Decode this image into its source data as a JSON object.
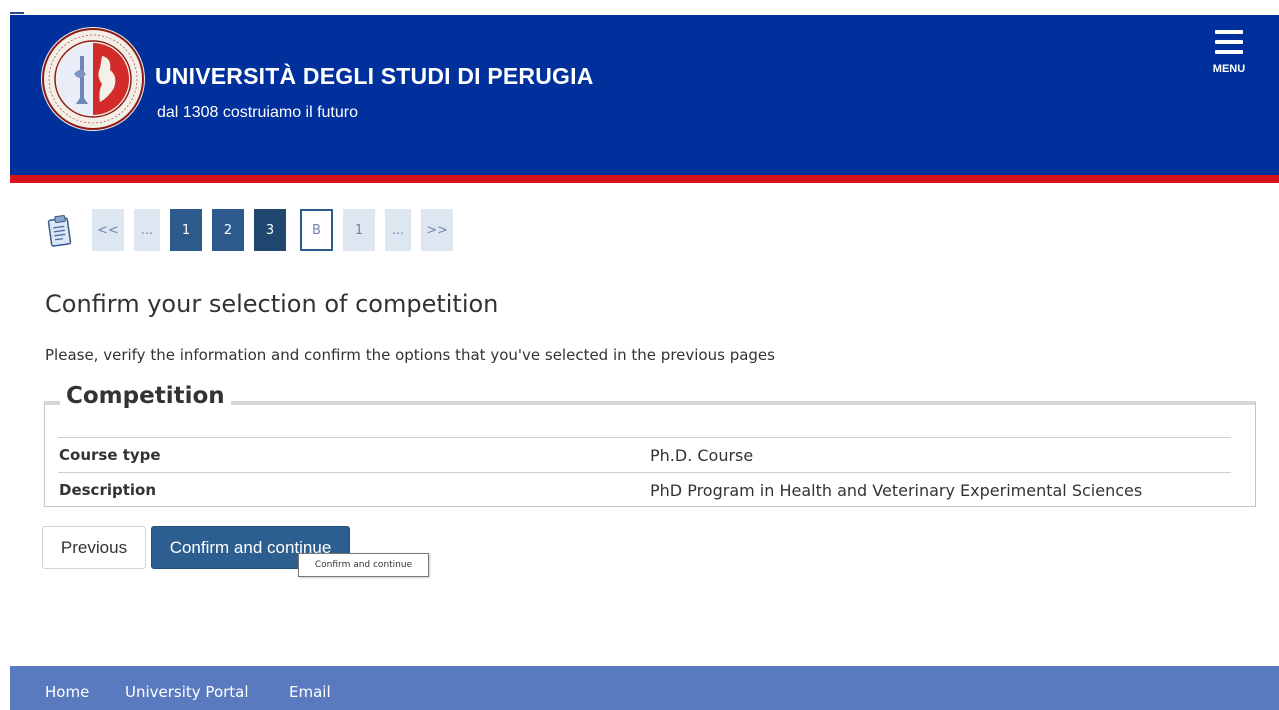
{
  "header": {
    "university_name": "UNIVERSITÀ DEGLI STUDI DI PERUGIA",
    "tagline": "dal 1308 costruiamo il futuro",
    "menu_label": "MENU",
    "logo_icon": "university-seal-icon",
    "colors": {
      "header_blue": "#00309c",
      "accent_red": "#d8121d"
    }
  },
  "steps": {
    "icon": "clipboard-icon",
    "items": [
      {
        "label": "<<",
        "state": "nav"
      },
      {
        "label": "...",
        "state": "nav"
      },
      {
        "label": "1",
        "state": "completed"
      },
      {
        "label": "2",
        "state": "completed"
      },
      {
        "label": "3",
        "state": "completed-active"
      },
      {
        "label": "B",
        "state": "current"
      },
      {
        "label": "1",
        "state": "upcoming"
      },
      {
        "label": "...",
        "state": "upcoming"
      },
      {
        "label": ">>",
        "state": "nav"
      }
    ]
  },
  "main": {
    "title": "Confirm your selection of competition",
    "intro": "Please, verify the information and confirm the options that you've selected in the previous pages",
    "section": {
      "legend": "Competition",
      "rows": [
        {
          "label": "Course type",
          "value": "Ph.D. Course"
        },
        {
          "label": "Description",
          "value": "PhD Program in Health and Veterinary Experimental Sciences"
        }
      ]
    }
  },
  "actions": {
    "previous_label": "Previous",
    "confirm_label": "Confirm and continue",
    "tooltip": "Confirm and continue"
  },
  "footer": {
    "links": [
      "Home",
      "University Portal",
      "Email"
    ],
    "color": "#5a7abf"
  }
}
